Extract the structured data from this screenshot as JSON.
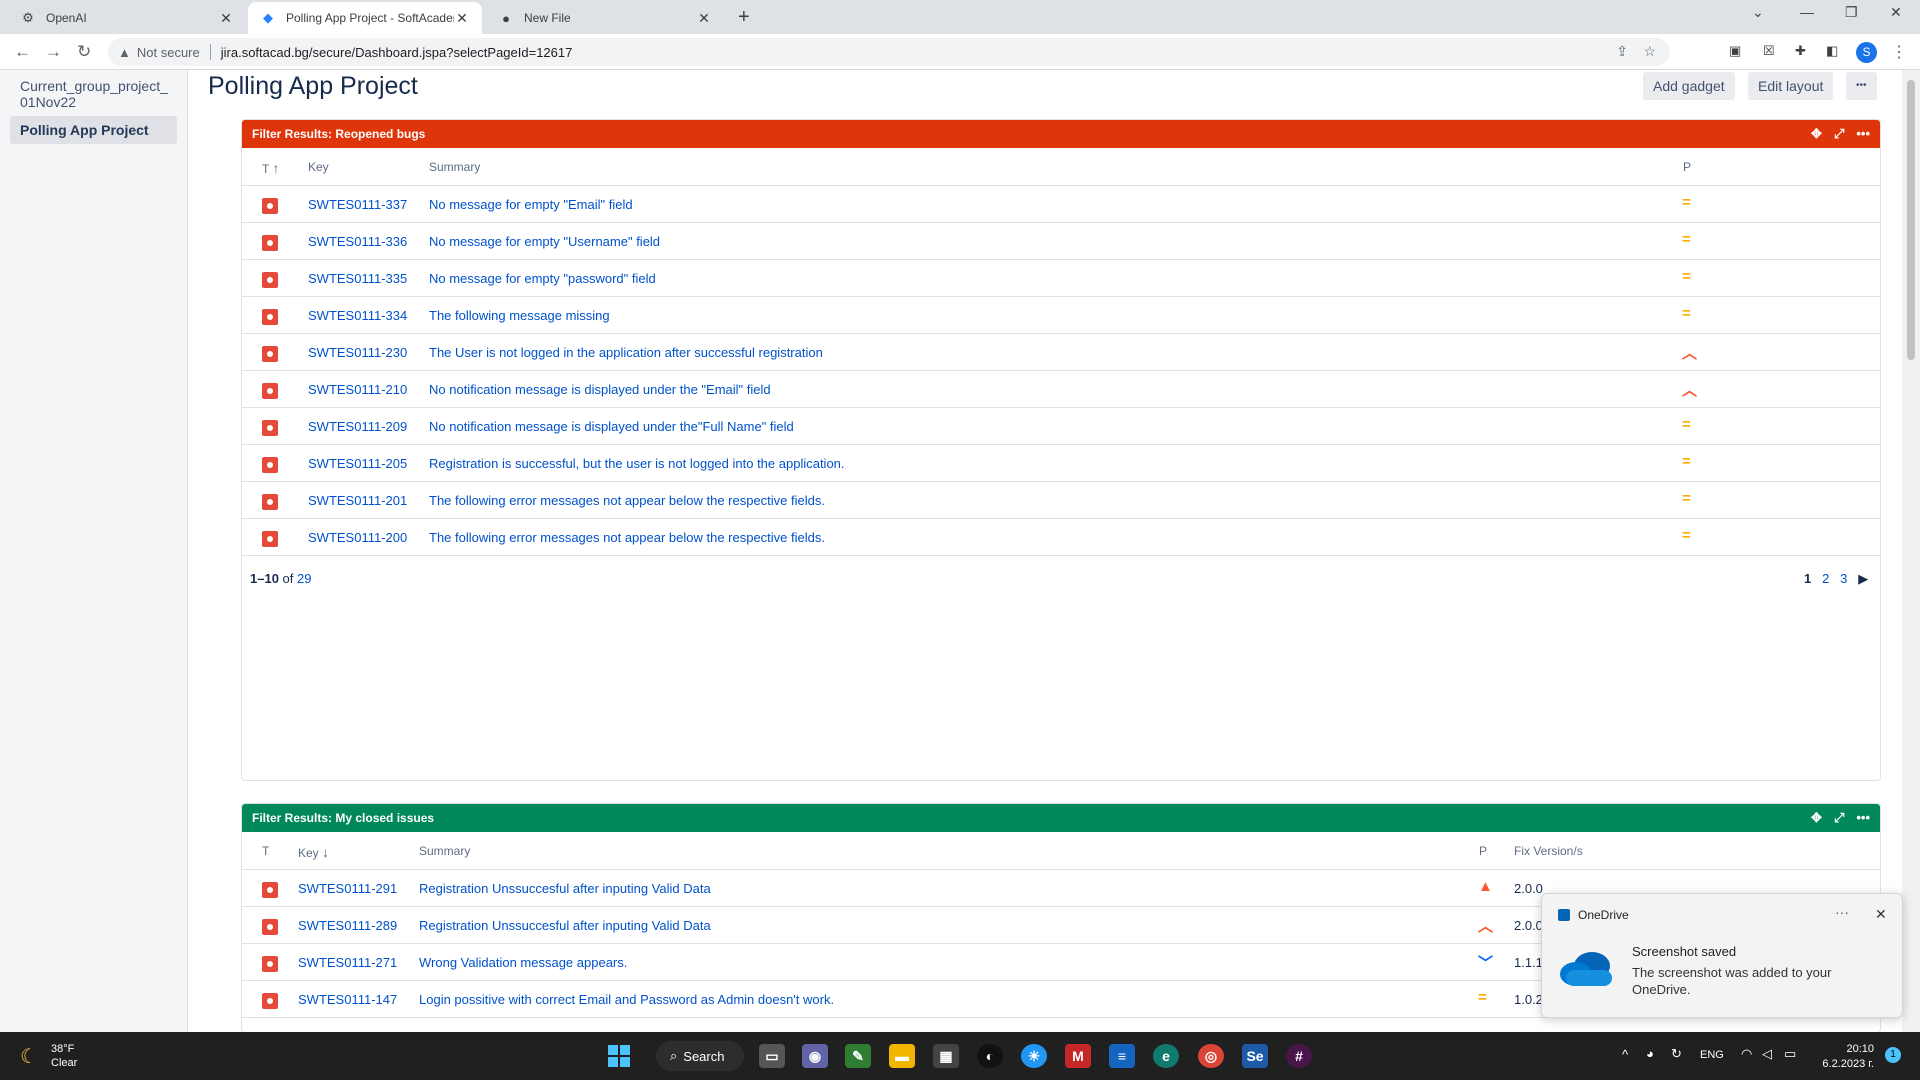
{
  "browser": {
    "tabs": [
      {
        "label": "OpenAI",
        "icon": "openai-icon"
      },
      {
        "label": "Polling App Project - SoftAcadem",
        "icon": "jira-icon"
      },
      {
        "label": "New File",
        "icon": "github-icon"
      }
    ],
    "not_secure": "Not secure",
    "url": "jira.softacad.bg/secure/Dashboard.jspa?selectPageId=12617",
    "profile_initial": "S"
  },
  "sidebar": {
    "items": [
      "Current_group_project_",
      "01Nov22"
    ],
    "active": "Polling App Project"
  },
  "page": {
    "title": "Polling App Project",
    "add_gadget": "Add gadget",
    "edit_layout": "Edit layout",
    "more": "•••"
  },
  "gadget1": {
    "title": "Filter Results: Reopened bugs",
    "color": "#de350b",
    "columns": {
      "t": "T",
      "key": "Key",
      "summary": "Summary",
      "p": "P"
    },
    "rows": [
      {
        "key": "SWTES0111-337",
        "summary": "No message for empty \"Email\" field",
        "priority": "medium"
      },
      {
        "key": "SWTES0111-336",
        "summary": "No message for empty \"Username\" field",
        "priority": "medium"
      },
      {
        "key": "SWTES0111-335",
        "summary": "No message for empty \"password\" field",
        "priority": "medium"
      },
      {
        "key": "SWTES0111-334",
        "summary": "The following message missing",
        "priority": "medium"
      },
      {
        "key": "SWTES0111-230",
        "summary": "The User is not logged in the application after successful registration",
        "priority": "high"
      },
      {
        "key": "SWTES0111-210",
        "summary": "No notification message is displayed under the \"Email\" field",
        "priority": "high"
      },
      {
        "key": "SWTES0111-209",
        "summary": "No notification message is displayed under the\"Full Name\" field",
        "priority": "medium"
      },
      {
        "key": "SWTES0111-205",
        "summary": "Registration is successful, but the user is not logged into the application.",
        "priority": "medium"
      },
      {
        "key": "SWTES0111-201",
        "summary": "The following error messages not appear below the respective fields.",
        "priority": "medium"
      },
      {
        "key": "SWTES0111-200",
        "summary": "The following error messages not appear below the respective fields.",
        "priority": "medium"
      }
    ],
    "pager": {
      "range": "1–10",
      "of": "of",
      "total": "29",
      "pages": [
        "1",
        "2",
        "3"
      ]
    }
  },
  "gadget2": {
    "title": "Filter Results: My closed issues",
    "color": "#00875a",
    "columns": {
      "t": "T",
      "key": "Key",
      "summary": "Summary",
      "p": "P",
      "fix": "Fix Version/s"
    },
    "rows": [
      {
        "key": "SWTES0111-291",
        "summary": "Registration Unssuccesful after inputing Valid Data",
        "priority": "highest",
        "fix": "2.0.0"
      },
      {
        "key": "SWTES0111-289",
        "summary": "Registration Unssuccesful after inputing Valid Data",
        "priority": "high",
        "fix": "2.0.0"
      },
      {
        "key": "SWTES0111-271",
        "summary": "Wrong Validation message appears.",
        "priority": "low",
        "fix": "1.1.1"
      },
      {
        "key": "SWTES0111-147",
        "summary": "Login possitive with correct Email and Password as Admin doesn't work.",
        "priority": "medium",
        "fix": "1.0.2"
      }
    ]
  },
  "toast": {
    "app": "OneDrive",
    "title": "Screenshot saved",
    "body": "The screenshot was added to your OneDrive."
  },
  "taskbar": {
    "temp": "38°F",
    "condition": "Clear",
    "search": "Search",
    "lang": "ENG",
    "time": "20:10",
    "date": "6.2.2023 г.",
    "notif_count": "1"
  }
}
